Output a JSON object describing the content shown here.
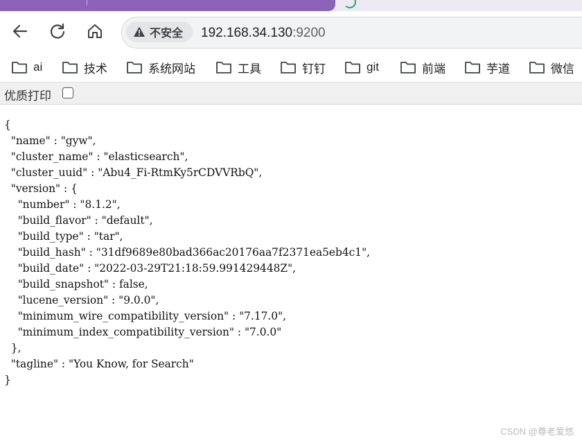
{
  "browser": {
    "security_label": "不安全",
    "url_host": "192.168.34.130",
    "url_port": ":9200"
  },
  "bookmarks": [
    {
      "label": "ai"
    },
    {
      "label": "技术"
    },
    {
      "label": "系统网站"
    },
    {
      "label": "工具"
    },
    {
      "label": "钉钉"
    },
    {
      "label": "git"
    },
    {
      "label": "前端"
    },
    {
      "label": "芋道"
    },
    {
      "label": "微信"
    }
  ],
  "print_bar": {
    "label": "优质打印",
    "checked": false
  },
  "json_response": {
    "text": "{\n  \"name\" : \"gyw\",\n  \"cluster_name\" : \"elasticsearch\",\n  \"cluster_uuid\" : \"Abu4_Fi-RtmKy5rCDVVRbQ\",\n  \"version\" : {\n    \"number\" : \"8.1.2\",\n    \"build_flavor\" : \"default\",\n    \"build_type\" : \"tar\",\n    \"build_hash\" : \"31df9689e80bad366ac20176aa7f2371ea5eb4c1\",\n    \"build_date\" : \"2022-03-29T21:18:59.991429448Z\",\n    \"build_snapshot\" : false,\n    \"lucene_version\" : \"9.0.0\",\n    \"minimum_wire_compatibility_version\" : \"7.17.0\",\n    \"minimum_index_compatibility_version\" : \"7.0.0\"\n  },\n  \"tagline\" : \"You Know, for Search\"\n}"
  },
  "watermark": "CSDN @尊老爱悠",
  "colors": {
    "tab_accent": "#8a63b8",
    "omnibox_bg": "#f1f3f4"
  }
}
